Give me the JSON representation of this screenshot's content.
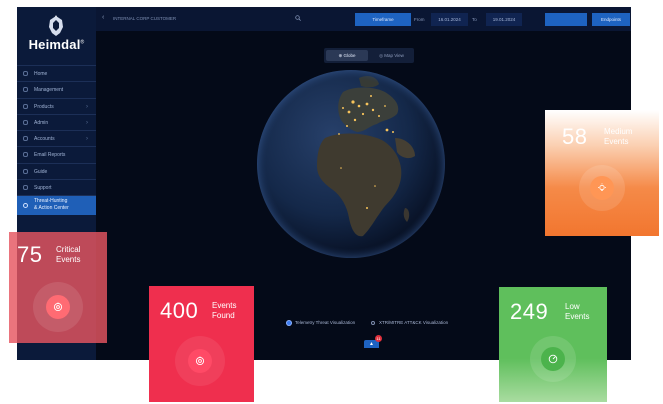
{
  "brand": {
    "name": "Heimdal",
    "trademark": "®"
  },
  "sidebar": {
    "items": [
      {
        "label": "Home",
        "icon": "home-icon",
        "has_submenu": false
      },
      {
        "label": "Management",
        "icon": "management-icon",
        "has_submenu": false
      },
      {
        "label": "Products",
        "icon": "products-icon",
        "has_submenu": true
      },
      {
        "label": "Admin",
        "icon": "admin-icon",
        "has_submenu": true
      },
      {
        "label": "Accounts",
        "icon": "accounts-icon",
        "has_submenu": true
      },
      {
        "label": "Email Reports",
        "icon": "email-icon",
        "has_submenu": false
      },
      {
        "label": "Guide",
        "icon": "guide-icon",
        "has_submenu": false
      },
      {
        "label": "Support",
        "icon": "support-icon",
        "has_submenu": false
      },
      {
        "label_line1": "Threat-Hunting",
        "label_line2": "& Action Center",
        "icon": "gear-icon",
        "active": true
      }
    ]
  },
  "topbar": {
    "collapse_glyph": "‹",
    "customer": "INTERNAL CORP CUSTOMER",
    "timeframe_label": "Timeframe",
    "from_label": "From",
    "from_value": "16.01.2024",
    "to_label": "To",
    "to_value": "19.01.2024",
    "endpoints_label": "Endpoints"
  },
  "view_toggle": {
    "globe": "Globe",
    "map": "Map View",
    "selected": "Globe"
  },
  "visualizations": {
    "telemetry": "Telemetry Threat Visualization",
    "xtr": "XTR/MITRE ATT&CK Visualization",
    "selected": "telemetry"
  },
  "footer": {
    "button_glyph": "▲",
    "badge": "11"
  },
  "cards": {
    "critical": {
      "count": "75",
      "line1": "Critical",
      "line2": "Events",
      "icon": "alert-target-icon",
      "color": "#e45b63"
    },
    "found": {
      "count": "400",
      "line1": "Events",
      "line2": "Found",
      "icon": "alert-target-icon",
      "color": "#ef2f4e"
    },
    "medium": {
      "count": "58",
      "line1": "Medium",
      "line2": "Events",
      "icon": "lightbulb-icon",
      "color": "#f37a3a"
    },
    "low": {
      "count": "249",
      "line1": "Low",
      "line2": "Events",
      "icon": "gauge-icon",
      "color": "#5fc45f"
    }
  },
  "colors": {
    "accent": "#1e63c1",
    "background": "#040a18",
    "sidebar": "#0b1a3a"
  }
}
